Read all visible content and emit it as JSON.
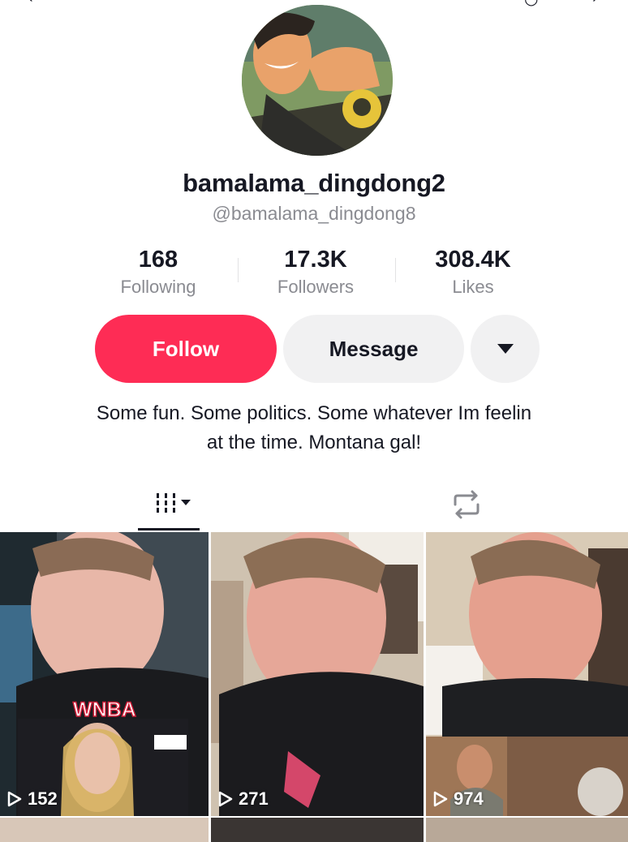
{
  "profile": {
    "display_name": "bamalama_dingdong2",
    "handle": "@bamalama_dingdong8",
    "bio_line1": "Some fun. Some politics. Some whatever Im feelin",
    "bio_line2": "at the time. Montana gal!"
  },
  "stats": [
    {
      "value": "168",
      "label": "Following"
    },
    {
      "value": "17.3K",
      "label": "Followers"
    },
    {
      "value": "308.4K",
      "label": "Likes"
    }
  ],
  "actions": {
    "follow_label": "Follow",
    "message_label": "Message",
    "more_icon": "caret-down-icon"
  },
  "tabs": [
    {
      "icon": "videos-grid-icon",
      "selected": true
    },
    {
      "icon": "repost-icon",
      "selected": false
    }
  ],
  "videos": [
    {
      "views": "152",
      "overlay_text": "WNBA"
    },
    {
      "views": "271"
    },
    {
      "views": "974"
    }
  ],
  "colors": {
    "accent": "#fe2c55",
    "button_gray": "#f1f1f2",
    "text_primary": "#161823",
    "text_secondary": "#8a8b91"
  }
}
